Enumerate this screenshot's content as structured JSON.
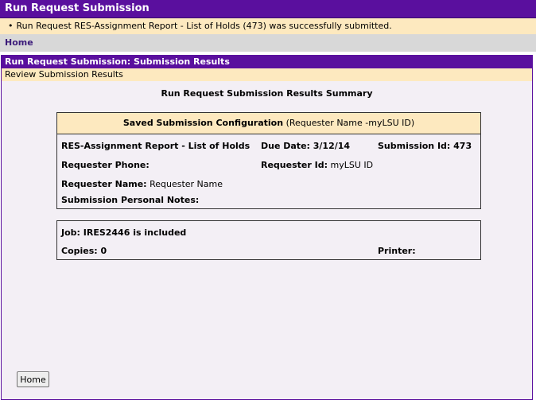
{
  "page": {
    "title": "Run Request Submission",
    "message": "Run Request RES-Assignment Report - List of Holds (473) was successfully submitted.",
    "home_link": "Home"
  },
  "panel": {
    "title": "Run Request Submission: Submission Results",
    "subtitle": "Review Submission Results",
    "summary_heading": "Run Request Submission Results Summary"
  },
  "config": {
    "heading_bold": "Saved Submission Configuration",
    "heading_detail": "(Requester Name -myLSU ID)",
    "report_name": "RES-Assignment Report - List of Holds",
    "due_date": "Due Date: 3/12/14",
    "submission_id": "Submission Id: 473",
    "requester_phone_label": "Requester Phone:",
    "requester_id_label": "Requester Id:",
    "requester_id_value": "myLSU ID",
    "requester_name_label": "Requester Name:",
    "requester_name_value": "Requester Name",
    "notes_label": "Submission Personal Notes:"
  },
  "job": {
    "job_text": "Job: IRES2446 is included",
    "copies": "Copies: 0",
    "printer_label": "Printer:"
  },
  "buttons": {
    "home": "Home"
  }
}
